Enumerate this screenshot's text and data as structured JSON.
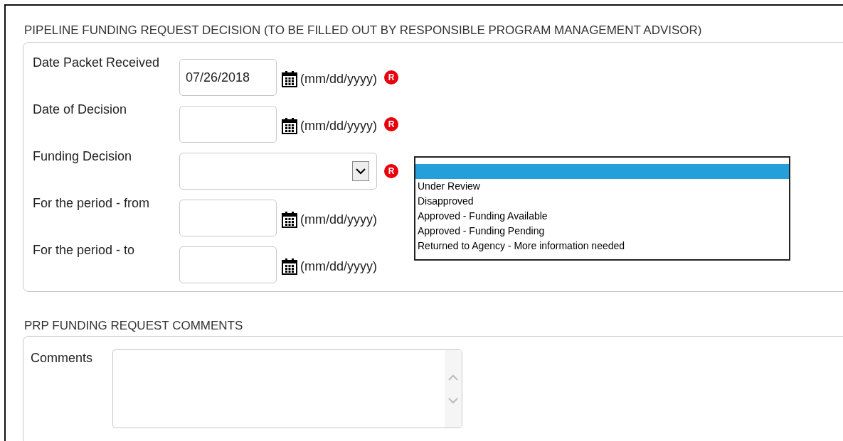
{
  "decision_section": {
    "title": "PIPELINE FUNDING REQUEST DECISION (TO BE FILLED OUT BY RESPONSIBLE PROGRAM MANAGEMENT ADVISOR)",
    "fields": [
      {
        "kind": "date",
        "label": "Date Packet Received",
        "value": "07/26/2018",
        "hint": "(mm/dd/yyyy)",
        "required_mark": "R"
      },
      {
        "kind": "date",
        "label": "Date of Decision",
        "hint": "(mm/dd/yyyy)",
        "required_mark": "R"
      },
      {
        "kind": "select",
        "label": "Funding Decision",
        "required_mark": "R",
        "expanded": true,
        "options": [
          {
            "selected": true
          },
          {
            "label": "Under Review",
            "selected": false
          },
          {
            "label": "Disapproved",
            "selected": false
          },
          {
            "label": "Approved - Funding Available",
            "selected": false
          },
          {
            "label": "Approved - Funding Pending",
            "selected": false
          },
          {
            "label": "Returned to Agency - More information needed",
            "selected": false
          }
        ]
      },
      {
        "kind": "date",
        "label": "For the period - from",
        "hint": "(mm/dd/yyyy)"
      },
      {
        "kind": "date",
        "label": "For the period - to",
        "hint": "(mm/dd/yyyy)"
      }
    ]
  },
  "comments_section": {
    "title": "PRP FUNDING REQUEST COMMENTS",
    "label": "Comments"
  }
}
